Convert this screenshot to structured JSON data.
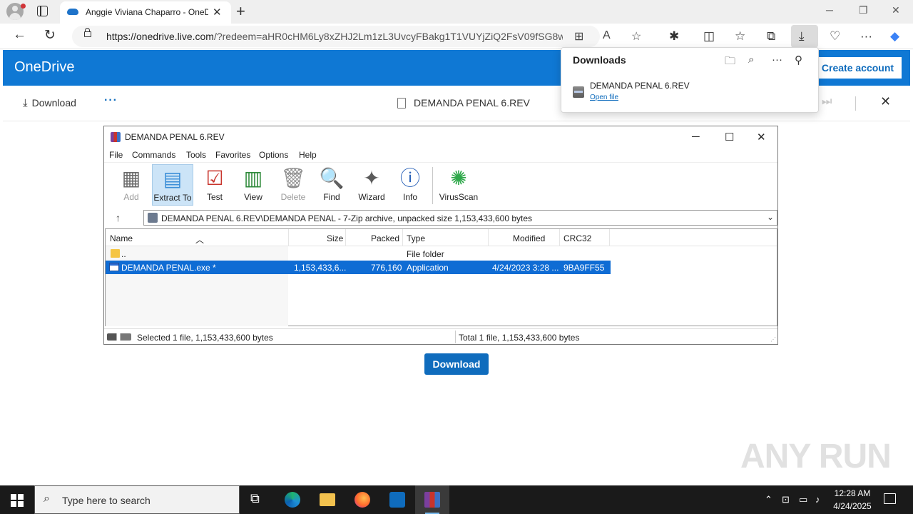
{
  "browser": {
    "tab_title": "Anggie Viviana Chaparro - OneD",
    "url_domain": "https://onedrive.live.com",
    "url_rest": "/?redeem=aHR0cHM6Ly8xZHJ2Lm1zL3UvcyFBakg1T1VUYjZiQ2FsV09fSG8wN...",
    "window_controls": {
      "minimize": "─",
      "maximize": "❐",
      "close": "✕"
    }
  },
  "downloads_panel": {
    "title": "Downloads",
    "item_name": "DEMANDA PENAL 6.REV",
    "item_action": "Open file"
  },
  "onedrive": {
    "brand": "OneDrive",
    "create_account": "Create account",
    "download_label": "Download",
    "more": "···",
    "file_name": "DEMANDA PENAL 6.REV",
    "download_button": "Download"
  },
  "winrar": {
    "title": "DEMANDA PENAL 6.REV",
    "menu": [
      "File",
      "Commands",
      "Tools",
      "Favorites",
      "Options",
      "Help"
    ],
    "toolbar": [
      {
        "label": "Add",
        "icon": "add-icon"
      },
      {
        "label": "Extract To",
        "icon": "extract-to-icon"
      },
      {
        "label": "Test",
        "icon": "test-icon"
      },
      {
        "label": "View",
        "icon": "view-icon"
      },
      {
        "label": "Delete",
        "icon": "delete-icon"
      },
      {
        "label": "Find",
        "icon": "find-icon"
      },
      {
        "label": "Wizard",
        "icon": "wizard-icon"
      },
      {
        "label": "Info",
        "icon": "info-icon"
      },
      {
        "label": "VirusScan",
        "icon": "virusscan-icon"
      }
    ],
    "path": "DEMANDA PENAL 6.REV\\DEMANDA PENAL - 7-Zip archive, unpacked size 1,153,433,600 bytes",
    "columns": [
      "Name",
      "Size",
      "Packed",
      "Type",
      "Modified",
      "CRC32"
    ],
    "rows": [
      {
        "name": "..",
        "size": "",
        "packed": "",
        "type": "File folder",
        "modified": "",
        "crc": ""
      },
      {
        "name": "DEMANDA PENAL.exe *",
        "size": "1,153,433,6...",
        "packed": "776,160",
        "type": "Application",
        "modified": "4/24/2023 3:28 ...",
        "crc": "9BA9FF55"
      }
    ],
    "status_left": "Selected 1 file, 1,153,433,600 bytes",
    "status_right": "Total 1 file, 1,153,433,600 bytes"
  },
  "watermark": "ANY RUN",
  "taskbar": {
    "search_placeholder": "Type here to search",
    "time": "12:28 AM",
    "date": "4/24/2025"
  }
}
